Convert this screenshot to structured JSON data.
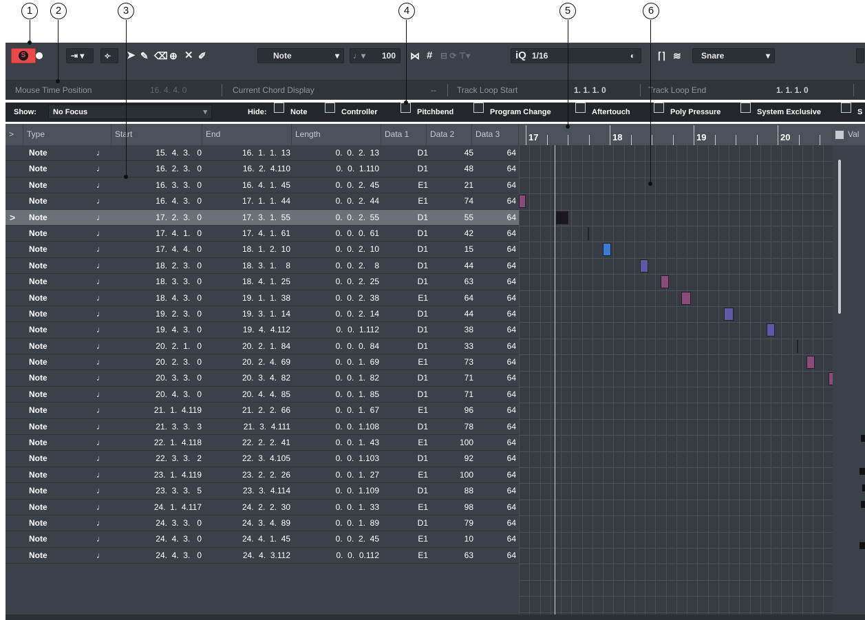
{
  "callouts": [
    "1",
    "2",
    "3",
    "4",
    "5",
    "6"
  ],
  "toolbar": {
    "velocity": "100",
    "insert_mode": "Note",
    "quantize_label": "iQ",
    "quantize_value": "1/16",
    "drum_label": "Snare"
  },
  "infobar": {
    "mouse_time_label": "Mouse Time Position",
    "mouse_time_value": "16. 4. 4.   0",
    "chord_label": "Current Chord Display",
    "chord_value": "--",
    "loop_start_label": "Track Loop Start",
    "loop_start_value": "1.  1.  1.   0",
    "loop_end_label": "Track Loop End",
    "loop_end_value": "1.  1.  1.   0"
  },
  "filter": {
    "show_label": "Show:",
    "show_value": "No Focus",
    "hide_label": "Hide:",
    "items": [
      "Note",
      "Controller",
      "Pitchbend",
      "Program Change",
      "Aftertouch",
      "Poly Pressure",
      "System Exclusive",
      "S"
    ]
  },
  "columns": [
    "Type",
    "Start",
    "End",
    "Length",
    "Data 1",
    "Data 2",
    "Data 3"
  ],
  "value_header": "Val",
  "ruler_marks": [
    "17",
    "18",
    "19",
    "20"
  ],
  "rows": [
    {
      "type": "Note",
      "start": "15.  4.  3.   0",
      "end": "16.  1.  1.  13",
      "len": "0.  0.  2.  13",
      "d1": "D1",
      "d2": "45",
      "d3": "64"
    },
    {
      "type": "Note",
      "start": "16.  2.  3.   0",
      "end": "16.  2.  4.110",
      "len": "0.  0.  1.110",
      "d1": "D1",
      "d2": "48",
      "d3": "64"
    },
    {
      "type": "Note",
      "start": "16.  3.  3.   0",
      "end": "16.  4.  1.  45",
      "len": "0.  0.  2.  45",
      "d1": "E1",
      "d2": "21",
      "d3": "64"
    },
    {
      "type": "Note",
      "start": "16.  4.  3.   0",
      "end": "17.  1.  1.  44",
      "len": "0.  0.  2.  44",
      "d1": "E1",
      "d2": "74",
      "d3": "64"
    },
    {
      "type": "Note",
      "start": "17.  2.  3.   0",
      "end": "17.  3.  1.  55",
      "len": "0.  0.  2.  55",
      "d1": "D1",
      "d2": "55",
      "d3": "64",
      "selected": true
    },
    {
      "type": "Note",
      "start": "17.  4.  1.   0",
      "end": "17.  4.  1.  61",
      "len": "0.  0.  0.  61",
      "d1": "D1",
      "d2": "42",
      "d3": "64"
    },
    {
      "type": "Note",
      "start": "17.  4.  4.   0",
      "end": "18.  1.  2.  10",
      "len": "0.  0.  2.  10",
      "d1": "D1",
      "d2": "15",
      "d3": "64"
    },
    {
      "type": "Note",
      "start": "18.  2.  3.   0",
      "end": "18.  3.  1.    8",
      "len": "0.  0.  2.    8",
      "d1": "D1",
      "d2": "44",
      "d3": "64"
    },
    {
      "type": "Note",
      "start": "18.  3.  3.   0",
      "end": "18.  4.  1.  25",
      "len": "0.  0.  2.  25",
      "d1": "D1",
      "d2": "63",
      "d3": "64"
    },
    {
      "type": "Note",
      "start": "18.  4.  3.   0",
      "end": "19.  1.  1.  38",
      "len": "0.  0.  2.  38",
      "d1": "E1",
      "d2": "64",
      "d3": "64"
    },
    {
      "type": "Note",
      "start": "19.  2.  3.   0",
      "end": "19.  3.  1.  14",
      "len": "0.  0.  2.  14",
      "d1": "D1",
      "d2": "44",
      "d3": "64"
    },
    {
      "type": "Note",
      "start": "19.  4.  3.   0",
      "end": "19.  4.  4.112",
      "len": "0.  0.  1.112",
      "d1": "D1",
      "d2": "38",
      "d3": "64"
    },
    {
      "type": "Note",
      "start": "20.  2.  1.   0",
      "end": "20.  2.  1.  84",
      "len": "0.  0.  0.  84",
      "d1": "D1",
      "d2": "33",
      "d3": "64"
    },
    {
      "type": "Note",
      "start": "20.  2.  3.   0",
      "end": "20.  2.  4.  69",
      "len": "0.  0.  1.  69",
      "d1": "E1",
      "d2": "73",
      "d3": "64"
    },
    {
      "type": "Note",
      "start": "20.  3.  3.   0",
      "end": "20.  3.  4.  82",
      "len": "0.  0.  1.  82",
      "d1": "D1",
      "d2": "71",
      "d3": "64"
    },
    {
      "type": "Note",
      "start": "20.  4.  3.   0",
      "end": "20.  4.  4.  85",
      "len": "0.  0.  1.  85",
      "d1": "D1",
      "d2": "71",
      "d3": "64"
    },
    {
      "type": "Note",
      "start": "21.  1.  4.119",
      "end": "21.  2.  2.  66",
      "len": "0.  0.  1.  67",
      "d1": "E1",
      "d2": "96",
      "d3": "64"
    },
    {
      "type": "Note",
      "start": "21.  3.  3.   3",
      "end": "21.  3.  4.111",
      "len": "0.  0.  1.108",
      "d1": "D1",
      "d2": "78",
      "d3": "64"
    },
    {
      "type": "Note",
      "start": "22.  1.  4.118",
      "end": "22.  2.  2.  41",
      "len": "0.  0.  1.  43",
      "d1": "E1",
      "d2": "100",
      "d3": "64"
    },
    {
      "type": "Note",
      "start": "22.  3.  3.   2",
      "end": "22.  3.  4.105",
      "len": "0.  0.  1.103",
      "d1": "D1",
      "d2": "92",
      "d3": "64"
    },
    {
      "type": "Note",
      "start": "23.  1.  4.119",
      "end": "23.  2.  2.  26",
      "len": "0.  0.  1.  27",
      "d1": "E1",
      "d2": "100",
      "d3": "64"
    },
    {
      "type": "Note",
      "start": "23.  3.  3.   5",
      "end": "23.  3.  4.114",
      "len": "0.  0.  1.109",
      "d1": "D1",
      "d2": "88",
      "d3": "64"
    },
    {
      "type": "Note",
      "start": "24.  1.  4.117",
      "end": "24.  2.  2.  30",
      "len": "0.  0.  1.  33",
      "d1": "E1",
      "d2": "98",
      "d3": "64"
    },
    {
      "type": "Note",
      "start": "24.  3.  3.   0",
      "end": "24.  3.  4.  89",
      "len": "0.  0.  1.  89",
      "d1": "D1",
      "d2": "79",
      "d3": "64"
    },
    {
      "type": "Note",
      "start": "24.  4.  3.   0",
      "end": "24.  4.  1.  45",
      "len": "0.  0.  2.  45",
      "d1": "E1",
      "d2": "10",
      "d3": "64"
    },
    {
      "type": "Note",
      "start": "24.  4.  3.   0",
      "end": "24.  4.  3.112",
      "len": "0.  0.  0.112",
      "d1": "E1",
      "d2": "63",
      "d3": "64"
    }
  ],
  "colors": {
    "event_pink": "#8a4a7a",
    "event_purple": "#5f5aa8",
    "event_blue": "#3a7bd5",
    "event_dark": "#1a1620",
    "solo": "#e84a4a"
  }
}
